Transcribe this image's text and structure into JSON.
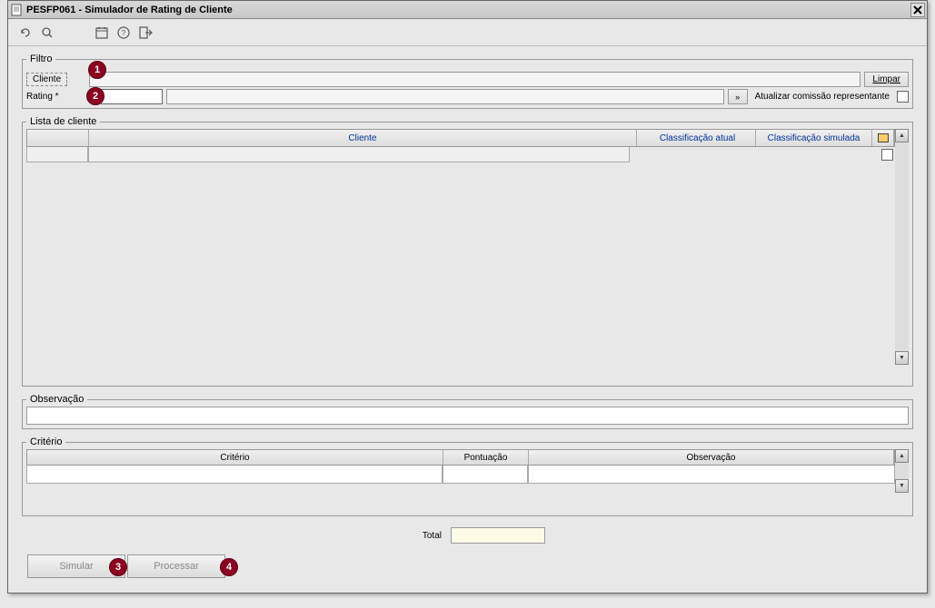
{
  "window": {
    "title": "PESFP061 - Simulador de Rating de Cliente"
  },
  "filtro": {
    "legend": "Filtro",
    "cliente_label": "Cliente",
    "limpar_label": "Limpar",
    "rating_label": "Rating *",
    "atualizar_label": "Atualizar comissão representante",
    "dblarrow": "»"
  },
  "lista": {
    "legend": "Lista de cliente",
    "col_cliente": "Cliente",
    "col_class_atual": "Classificação atual",
    "col_class_sim": "Classificação simulada"
  },
  "observacao": {
    "legend": "Observação"
  },
  "criterio": {
    "legend": "Critério",
    "col_criterio": "Critério",
    "col_pontuacao": "Pontuação",
    "col_obs": "Observação",
    "total_label": "Total"
  },
  "buttons": {
    "simular": "Simular",
    "processar": "Processar"
  },
  "badges": {
    "b1": "1",
    "b2": "2",
    "b3": "3",
    "b4": "4"
  }
}
